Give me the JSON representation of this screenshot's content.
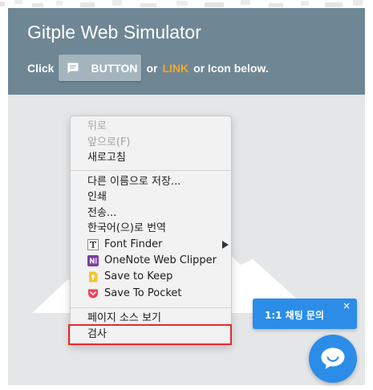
{
  "header": {
    "title": "Gitple Web Simulator",
    "click_label": "Click",
    "button_label": "BUTTON",
    "or_label": "or",
    "link_label": "LINK",
    "tail_label": "or Icon below."
  },
  "context_menu": {
    "items": [
      {
        "label": "뒤로",
        "disabled": true
      },
      {
        "label": "앞으로(F)",
        "disabled": true
      },
      {
        "label": "새로고침",
        "disabled": false
      },
      {
        "label": "다른 이름으로 저장...",
        "disabled": false
      },
      {
        "label": "인쇄",
        "disabled": false
      },
      {
        "label": "전송...",
        "disabled": false
      },
      {
        "label": "한국어(으)로 번역",
        "disabled": false
      },
      {
        "label": "Font Finder",
        "icon": "font-finder-icon",
        "has_submenu": true
      },
      {
        "label": "OneNote Web Clipper",
        "icon": "onenote-icon"
      },
      {
        "label": "Save to Keep",
        "icon": "keep-icon"
      },
      {
        "label": "Save To Pocket",
        "icon": "pocket-icon"
      },
      {
        "label": "페이지 소스 보기",
        "disabled": false
      },
      {
        "label": "검사",
        "disabled": false,
        "highlighted": true
      }
    ]
  },
  "chat": {
    "bubble_label": "1:1 채팅 문의",
    "close_label": "×"
  },
  "colors": {
    "header_bg": "#6f8795",
    "link": "#f5a623",
    "chat_blue": "#2b8de8",
    "highlight": "#e8292c"
  }
}
